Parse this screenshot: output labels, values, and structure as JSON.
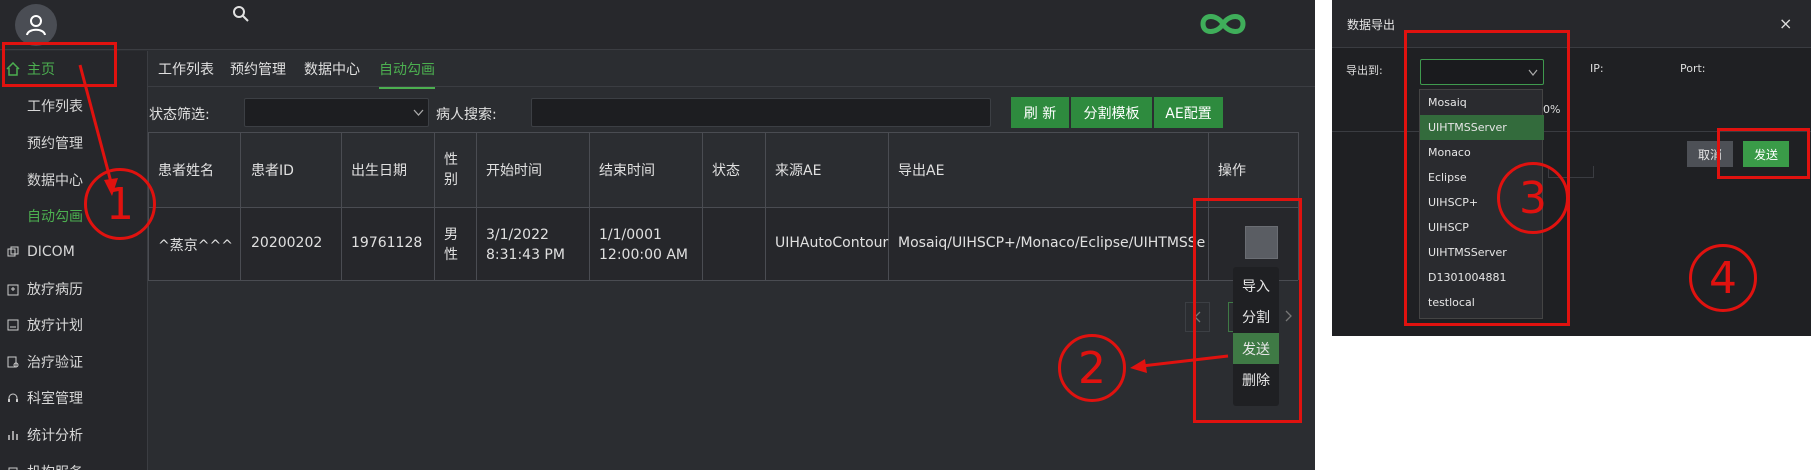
{
  "left_app": {
    "nav": {
      "home": "主页",
      "sub_items": [
        "工作列表",
        "预约管理",
        "数据中心",
        "自动勾画"
      ],
      "items": [
        "DICOM",
        "放疗病历",
        "放疗计划",
        "治疗验证",
        "科室管理",
        "统计分析",
        "机构服务"
      ]
    },
    "tabs": [
      "工作列表",
      "预约管理",
      "数据中心",
      "自动勾画"
    ],
    "filter": {
      "status_label": "状态筛选:",
      "patient_search_label": "病人搜索:"
    },
    "buttons": {
      "refresh": "刷 新",
      "segment_template": "分割模板",
      "ae_config": "AE配置"
    },
    "table": {
      "headers": [
        "患者姓名",
        "患者ID",
        "出生日期",
        "性别",
        "开始时间",
        "结束时间",
        "状态",
        "来源AE",
        "导出AE",
        "操作"
      ],
      "row": {
        "name": "^蒸京^^^",
        "id": "20200202",
        "dob": "19761128",
        "gender": "男性",
        "start_time": "3/1/2022 8:31:43 PM",
        "end_time": "1/1/0001 12:00:00 AM",
        "status": "",
        "source_ae": "UIHAutoContour",
        "export_ae": "Mosaiq/UIHSCP+/Monaco/Eclipse/UIHTMSServer"
      }
    },
    "context_menu": [
      "导入",
      "分割",
      "发送",
      "删除"
    ],
    "context_menu_active": "发送",
    "colors": {
      "accent": "#4caf50",
      "annotation": "#e0120f"
    }
  },
  "annotations": [
    "1",
    "2",
    "3",
    "4"
  ],
  "dialog": {
    "title": "数据导出",
    "close": "×",
    "export_to_label": "导出到:",
    "ip_label": "IP:",
    "port_label": "Port:",
    "percent": "0%",
    "cancel": "取消",
    "send": "发送",
    "options": [
      "Mosaiq",
      "UIHTMSServer",
      "Monaco",
      "Eclipse",
      "UIHSCP+",
      "UIHSCP",
      "UIHTMSServer",
      "D1301004881",
      "testlocal"
    ],
    "selected_option": "UIHTMSServer"
  }
}
